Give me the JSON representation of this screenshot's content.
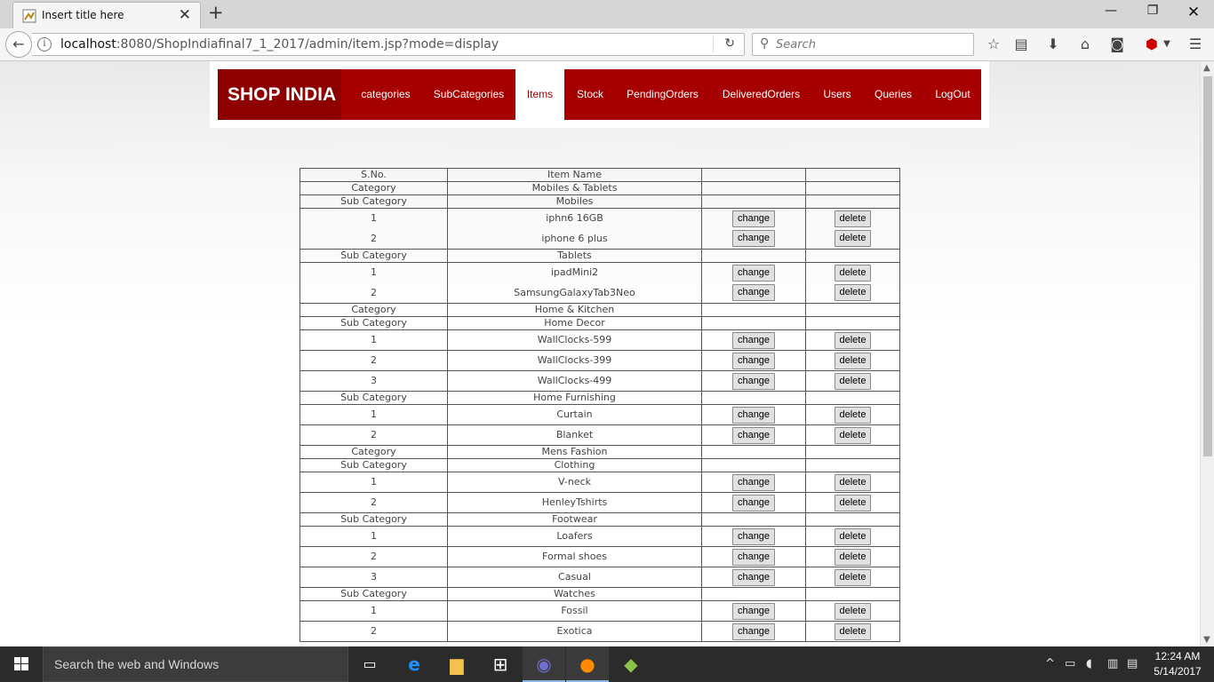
{
  "browser": {
    "tab_title": "Insert title here",
    "url_host": "localhost",
    "url_rest": ":8080/ShopIndiafinal7_1_2017/admin/item.jsp?mode=display",
    "search_placeholder": "Search"
  },
  "site": {
    "brand": "SHOP INDIA",
    "nav": [
      {
        "label": "categories",
        "active": false
      },
      {
        "label": "SubCategories",
        "active": false
      },
      {
        "label": "Items",
        "active": true
      },
      {
        "label": "Stock",
        "active": false
      },
      {
        "label": "PendingOrders",
        "active": false
      },
      {
        "label": "DeliveredOrders",
        "active": false
      },
      {
        "label": "Users",
        "active": false
      },
      {
        "label": "Queries",
        "active": false
      },
      {
        "label": "LogOut",
        "active": false
      }
    ],
    "accent_color": "#a60000"
  },
  "table": {
    "headers": [
      "S.No.",
      "Item Name"
    ],
    "change_label": "change",
    "delete_label": "delete",
    "rows": [
      {
        "kind": "category",
        "label": "Category",
        "name": "Mobiles & Tablets"
      },
      {
        "kind": "sub",
        "label": "Sub Category",
        "name": "Mobiles"
      },
      {
        "kind": "item",
        "no": "1",
        "name": "iphn6 16GB",
        "pos": "first"
      },
      {
        "kind": "item",
        "no": "2",
        "name": "iphone 6 plus",
        "pos": "last"
      },
      {
        "kind": "sub",
        "label": "Sub Category",
        "name": "Tablets"
      },
      {
        "kind": "item",
        "no": "1",
        "name": "ipadMini2",
        "pos": "first"
      },
      {
        "kind": "item",
        "no": "2",
        "name": "SamsungGalaxyTab3Neo",
        "pos": "last"
      },
      {
        "kind": "category",
        "label": "Category",
        "name": "Home & Kitchen"
      },
      {
        "kind": "sub",
        "label": "Sub Category",
        "name": "Home Decor"
      },
      {
        "kind": "item",
        "no": "1",
        "name": "WallClocks-599",
        "pos": "single"
      },
      {
        "kind": "item",
        "no": "2",
        "name": "WallClocks-399",
        "pos": "single"
      },
      {
        "kind": "item",
        "no": "3",
        "name": "WallClocks-499",
        "pos": "single"
      },
      {
        "kind": "sub",
        "label": "Sub Category",
        "name": "Home Furnishing"
      },
      {
        "kind": "item",
        "no": "1",
        "name": "Curtain",
        "pos": "single"
      },
      {
        "kind": "item",
        "no": "2",
        "name": "Blanket",
        "pos": "single"
      },
      {
        "kind": "category",
        "label": "Category",
        "name": "Mens Fashion"
      },
      {
        "kind": "sub",
        "label": "Sub Category",
        "name": "Clothing"
      },
      {
        "kind": "item",
        "no": "1",
        "name": "V-neck",
        "pos": "single"
      },
      {
        "kind": "item",
        "no": "2",
        "name": "HenleyTshirts",
        "pos": "single"
      },
      {
        "kind": "sub",
        "label": "Sub Category",
        "name": "Footwear"
      },
      {
        "kind": "item",
        "no": "1",
        "name": "Loafers",
        "pos": "single"
      },
      {
        "kind": "item",
        "no": "2",
        "name": "Formal shoes",
        "pos": "single"
      },
      {
        "kind": "item",
        "no": "3",
        "name": "Casual",
        "pos": "single"
      },
      {
        "kind": "sub",
        "label": "Sub Category",
        "name": "Watches"
      },
      {
        "kind": "item",
        "no": "1",
        "name": "Fossil",
        "pos": "single"
      },
      {
        "kind": "item",
        "no": "2",
        "name": "Exotica",
        "pos": "single"
      }
    ]
  },
  "taskbar": {
    "search_text": "Search the web and Windows",
    "time": "12:24 AM",
    "date": "5/14/2017"
  }
}
